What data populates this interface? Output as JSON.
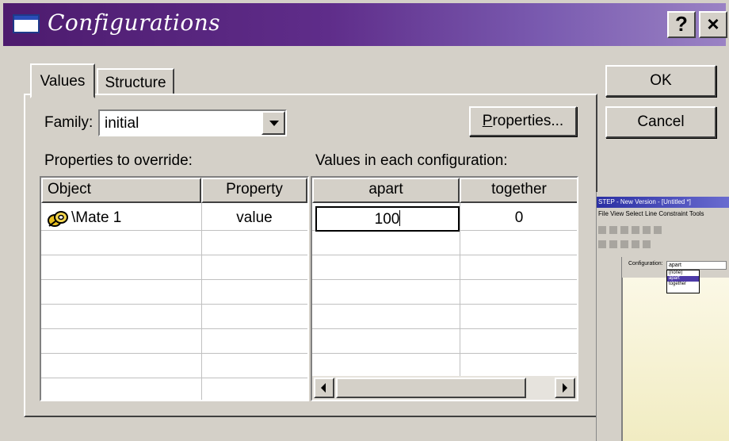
{
  "window": {
    "title": "Configurations"
  },
  "titlebar": {
    "help_label": "?",
    "close_label": "×"
  },
  "tabs": [
    {
      "label": "Values",
      "active": true
    },
    {
      "label": "Structure",
      "active": false
    }
  ],
  "family": {
    "label": "Family:",
    "value": "initial"
  },
  "buttons": {
    "properties": {
      "label": "Properties...",
      "underline_char": "P"
    },
    "ok": "OK",
    "cancel": "Cancel"
  },
  "override_section": {
    "label": "Properties to override:",
    "columns": [
      "Object",
      "Property"
    ],
    "rows": [
      {
        "object": "\\Mate 1",
        "object_icon": "mate-icon",
        "property": "value"
      }
    ]
  },
  "values_section": {
    "label": "Values in each configuration:",
    "columns": [
      "apart",
      "together"
    ],
    "rows": [
      {
        "apart": "100",
        "together": "0",
        "editing": "apart"
      }
    ]
  },
  "inset_thumbnail": {
    "title": "STEP - New Version - [Untitled *]",
    "menu": "File  View  Select  Line  Constraint  Tools",
    "configuration_label": "Configuration:",
    "configuration_value": "apart",
    "dropdown_items": [
      "(none)",
      "apart",
      "together"
    ],
    "selected_item": "apart"
  },
  "colors": {
    "titlebar_start": "#4d1b6e",
    "titlebar_end": "#9a82c4",
    "dialog_face": "#d4d0c8",
    "selection": "#4d3aa8"
  }
}
